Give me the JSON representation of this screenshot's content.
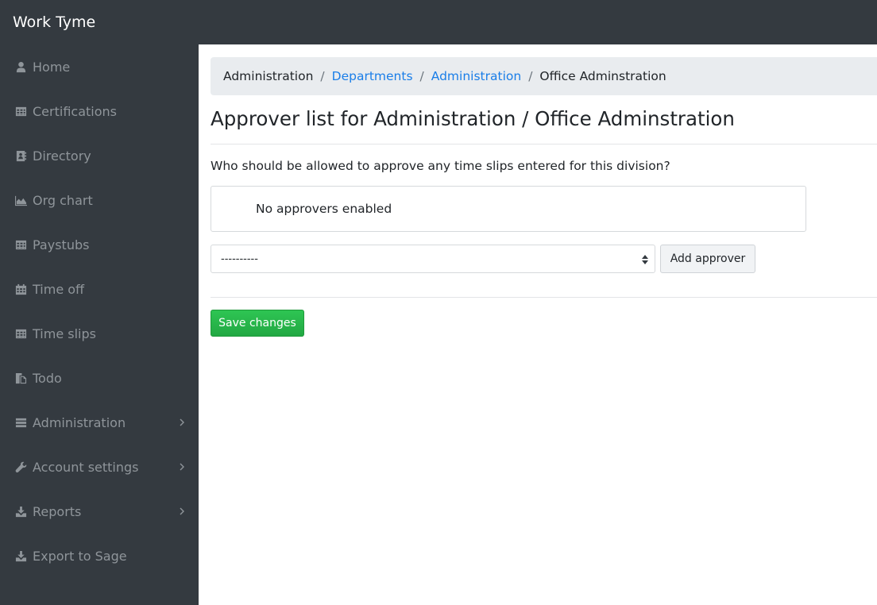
{
  "app": {
    "title": "Work Tyme"
  },
  "sidebar": {
    "items": [
      {
        "label": "Home",
        "icon": "user-icon",
        "has_submenu": false
      },
      {
        "label": "Certifications",
        "icon": "table-icon",
        "has_submenu": false
      },
      {
        "label": "Directory",
        "icon": "address-book-icon",
        "has_submenu": false
      },
      {
        "label": "Org chart",
        "icon": "area-chart-icon",
        "has_submenu": false
      },
      {
        "label": "Paystubs",
        "icon": "table-icon",
        "has_submenu": false
      },
      {
        "label": "Time off",
        "icon": "calendar-icon",
        "has_submenu": false
      },
      {
        "label": "Time slips",
        "icon": "table-icon",
        "has_submenu": false
      },
      {
        "label": "Todo",
        "icon": "copy-icon",
        "has_submenu": false
      },
      {
        "label": "Administration",
        "icon": "server-icon",
        "has_submenu": true
      },
      {
        "label": "Account settings",
        "icon": "wrench-icon",
        "has_submenu": true
      },
      {
        "label": "Reports",
        "icon": "download-icon",
        "has_submenu": true
      },
      {
        "label": "Export to Sage",
        "icon": "download-icon",
        "has_submenu": false
      }
    ]
  },
  "breadcrumb": {
    "items": [
      {
        "label": "Administration",
        "link": false
      },
      {
        "label": "Departments",
        "link": true
      },
      {
        "label": "Administration",
        "link": true
      },
      {
        "label": "Office Adminstration",
        "link": false
      }
    ],
    "separator": "/"
  },
  "page": {
    "title": "Approver list for Administration / Office Adminstration",
    "question": "Who should be allowed to approve any time slips entered for this division?",
    "approvers_empty": "No approvers enabled",
    "select_value": "----------",
    "add_button": "Add approver",
    "save_button": "Save changes"
  },
  "colors": {
    "sidebar_bg": "#343a40",
    "link": "#1a7ee8",
    "success": "#28a745"
  }
}
